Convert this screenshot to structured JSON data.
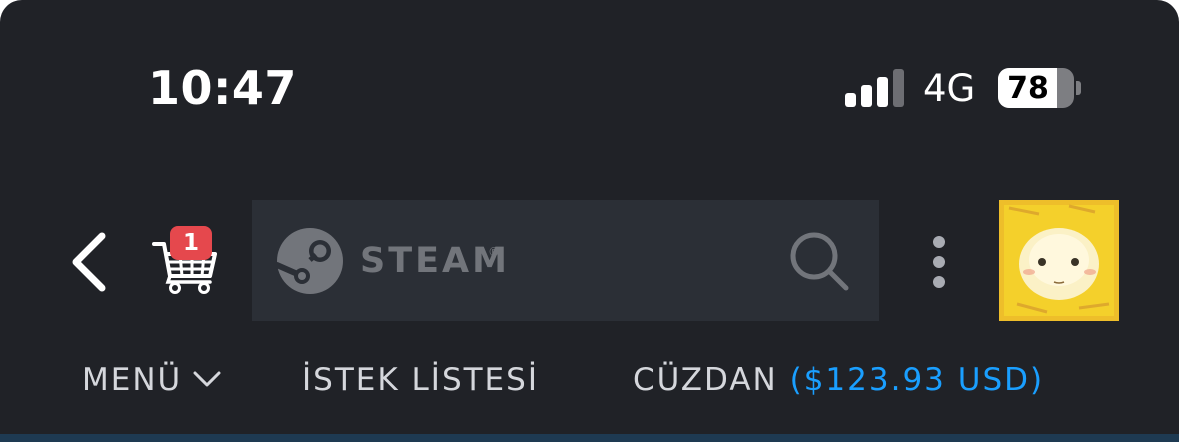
{
  "status_bar": {
    "time": "10:47",
    "network": "4G",
    "battery_level": "78",
    "battery_fraction": 0.78,
    "signal_bars_active": 3,
    "signal_bars_total": 4
  },
  "toolbar": {
    "back_icon": "chevron-left-icon",
    "cart_icon": "shopping-cart-icon",
    "cart_badge_count": "1",
    "search": {
      "brand": "STEAM",
      "brand_mark": "®",
      "logo_icon": "steam-logo-icon",
      "search_icon": "magnifier-icon"
    },
    "more_icon": "vertical-dots-icon",
    "avatar_colors": {
      "background": "#f5d12a",
      "face": "#fbf1c6"
    }
  },
  "nav": {
    "menu_label": "MENÜ",
    "menu_icon": "chevron-down-icon",
    "wishlist_label": "İSTEK LİSTESİ",
    "wallet_label": "CÜZDAN",
    "wallet_balance": "($123.93 USD)"
  },
  "colors": {
    "background": "#202227",
    "search_background": "#2b2f36",
    "badge": "#e5484d",
    "accent_blue": "#1a9fff",
    "nav_text": "#d5d7dc"
  }
}
